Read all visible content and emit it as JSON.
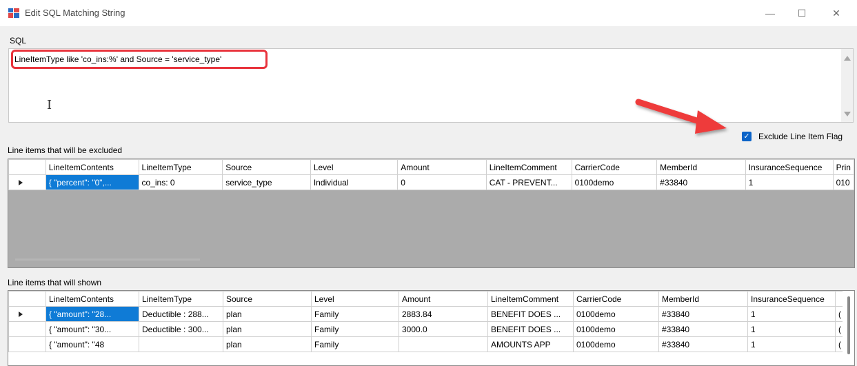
{
  "window": {
    "title": "Edit SQL Matching String",
    "minimize": "—",
    "maximize": "☐",
    "close": "✕"
  },
  "sql": {
    "label": "SQL",
    "text": "LineItemType like 'co_ins:%' and Source = 'service_type'"
  },
  "exclude_flag": {
    "label": "Exclude Line Item Flag",
    "checked": true,
    "check_glyph": "✓"
  },
  "excluded": {
    "label": "Line items that will be excluded",
    "columns": [
      "LineItemContents",
      "LineItemType",
      "Source",
      "Level",
      "Amount",
      "LineItemComment",
      "CarrierCode",
      "MemberId",
      "InsuranceSequence",
      "Prin"
    ],
    "rows": [
      [
        "{ \"percent\": \"0\",...",
        "co_ins: 0",
        "service_type",
        "Individual",
        "0",
        "CAT - PREVENT...",
        "0100demo",
        "#33840",
        "1",
        "010"
      ]
    ]
  },
  "shown": {
    "label": "Line items that will shown",
    "columns": [
      "LineItemContents",
      "LineItemType",
      "Source",
      "Level",
      "Amount",
      "LineItemComment",
      "CarrierCode",
      "MemberId",
      "InsuranceSequence",
      ""
    ],
    "rows": [
      [
        "{ \"amount\": \"28...",
        "Deductible : 288...",
        "plan",
        "Family",
        "2883.84",
        "BENEFIT DOES ...",
        "0100demo",
        "#33840",
        "1",
        "("
      ],
      [
        "{ \"amount\": \"30...",
        "Deductible : 300...",
        "plan",
        "Family",
        "3000.0",
        "BENEFIT DOES ...",
        "0100demo",
        "#33840",
        "1",
        "("
      ],
      [
        "{ \"amount\": \"48",
        "",
        "plan",
        "Family",
        "",
        "AMOUNTS APP",
        "0100demo",
        "#33840",
        "1",
        "("
      ]
    ]
  },
  "colors": {
    "highlight": "#e8333c",
    "selection": "#0f7bd6",
    "checkbox": "#0b63c8"
  }
}
